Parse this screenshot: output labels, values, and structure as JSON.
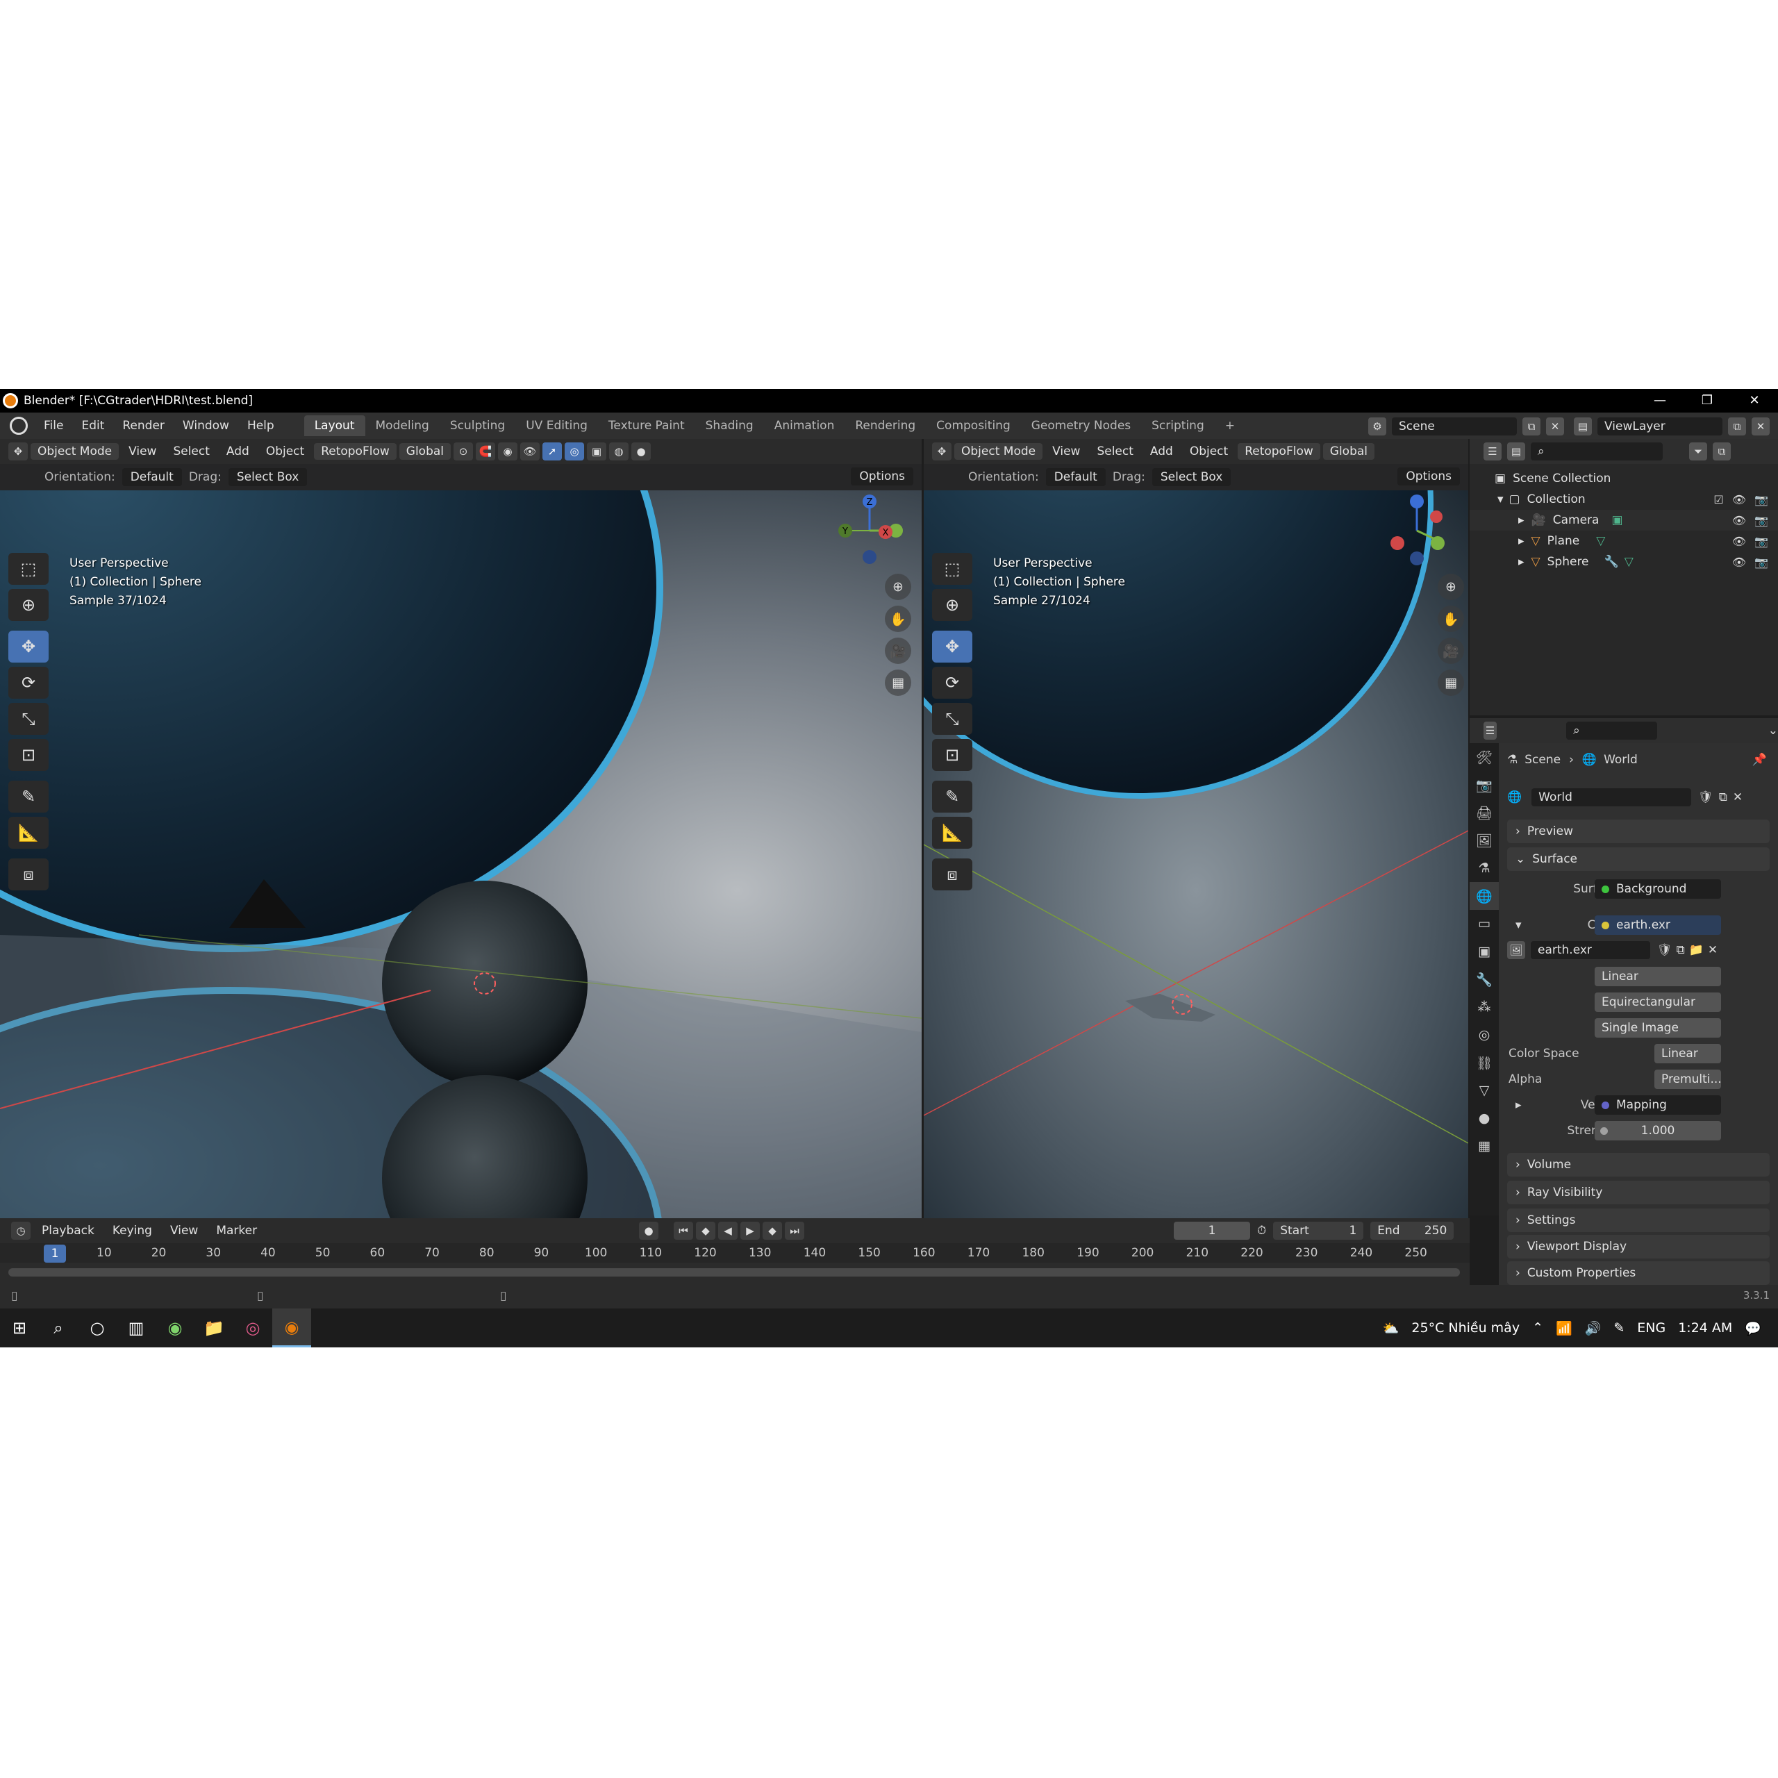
{
  "window": {
    "title": "Blender* [F:\\CGtrader\\HDRI\\test.blend]",
    "min": "—",
    "restore": "❐",
    "close": "✕"
  },
  "menu": [
    "File",
    "Edit",
    "Render",
    "Window",
    "Help"
  ],
  "workspaces": [
    "Layout",
    "Modeling",
    "Sculpting",
    "UV Editing",
    "Texture Paint",
    "Shading",
    "Animation",
    "Rendering",
    "Compositing",
    "Geometry Nodes",
    "Scripting",
    "+"
  ],
  "scene": {
    "name": "Scene",
    "view_layer": "ViewLayer"
  },
  "viewport_left": {
    "mode": "Object Mode",
    "view": "View",
    "select": "Select",
    "add": "Add",
    "object": "Object",
    "addon": "RetopoFlow",
    "transform": "Global",
    "orientation_label": "Orientation:",
    "orientation": "Default",
    "drag_label": "Drag:",
    "drag": "Select Box",
    "options": "Options",
    "overlay_line1": "User Perspective",
    "overlay_line2": "(1) Collection | Sphere",
    "overlay_line3": "Sample 37/1024"
  },
  "viewport_right": {
    "mode": "Object Mode",
    "view": "View",
    "select": "Select",
    "add": "Add",
    "object": "Object",
    "addon": "RetopoFlow",
    "transform": "Global",
    "orientation_label": "Orientation:",
    "orientation": "Default",
    "drag_label": "Drag:",
    "drag": "Select Box",
    "options": "Options",
    "overlay_line1": "User Perspective",
    "overlay_line2": "(1) Collection | Sphere",
    "overlay_line3": "Sample 27/1024"
  },
  "gizmo": {
    "x": "X",
    "y": "Y",
    "z": "Z"
  },
  "outliner": {
    "root": "Scene Collection",
    "collection": "Collection",
    "items": [
      "Camera",
      "Plane",
      "Sphere"
    ]
  },
  "properties": {
    "breadcrumb_scene": "Scene",
    "breadcrumb_world": "World",
    "world_name": "World",
    "panels": {
      "preview": "Preview",
      "surface": "Surface",
      "volume": "Volume",
      "ray_visibility": "Ray Visibility",
      "settings": "Settings",
      "viewport_display": "Viewport Display",
      "custom_properties": "Custom Properties"
    },
    "surface_label": "Surface",
    "surface_value": "Background",
    "color_label": "Color",
    "color_value": "earth.exr",
    "image_name": "earth.exr",
    "interpolation": "Linear",
    "projection": "Equirectangular",
    "source": "Single Image",
    "color_space_label": "Color Space",
    "color_space": "Linear",
    "alpha_label": "Alpha",
    "alpha": "Premulti...",
    "vector_label": "Vector",
    "vector_value": "Mapping",
    "strength_label": "Strength",
    "strength_value": "1.000",
    "colors": {
      "shader_green": "#3ec43e",
      "color_yellow": "#d8c43a",
      "vector_purple": "#6363c7",
      "strength_gray": "#a1a1a1"
    }
  },
  "timeline": {
    "playback": "Playback",
    "keying": "Keying",
    "view": "View",
    "marker": "Marker",
    "current_frame": "1",
    "start_label": "Start",
    "start": "1",
    "end_label": "End",
    "end": "250",
    "ticks": [
      "1",
      "10",
      "20",
      "30",
      "40",
      "50",
      "60",
      "70",
      "80",
      "90",
      "100",
      "110",
      "120",
      "130",
      "140",
      "150",
      "160",
      "170",
      "180",
      "190",
      "200",
      "210",
      "220",
      "230",
      "240",
      "250"
    ]
  },
  "status": {
    "version": "3.3.1"
  },
  "taskbar": {
    "weather": "25°C Nhiều mây",
    "lang": "ENG",
    "time": "1:24 AM"
  }
}
